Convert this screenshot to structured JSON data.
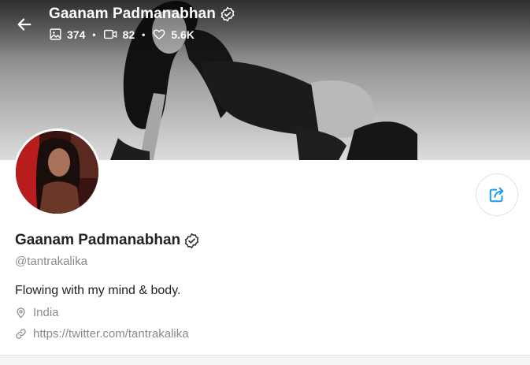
{
  "header": {
    "title": "Gaanam Padmanabhan",
    "stats": {
      "photos": "374",
      "videos": "82",
      "likes": "5.6K"
    }
  },
  "profile": {
    "name": "Gaanam Padmanabhan",
    "handle": "@tantrakalika",
    "bio": "Flowing with my mind & body.",
    "location": "India",
    "url": "https://twitter.com/tantrakalika"
  },
  "icons": {
    "back": "arrow-left-icon",
    "verified": "verified-badge-icon",
    "photos": "image-icon",
    "videos": "video-icon",
    "likes": "heart-icon",
    "share": "share-icon",
    "location": "location-pin-icon",
    "link": "link-icon"
  },
  "colors": {
    "accent": "#1d9bf0",
    "muted_text": "#8a8a8a",
    "white": "#ffffff"
  }
}
